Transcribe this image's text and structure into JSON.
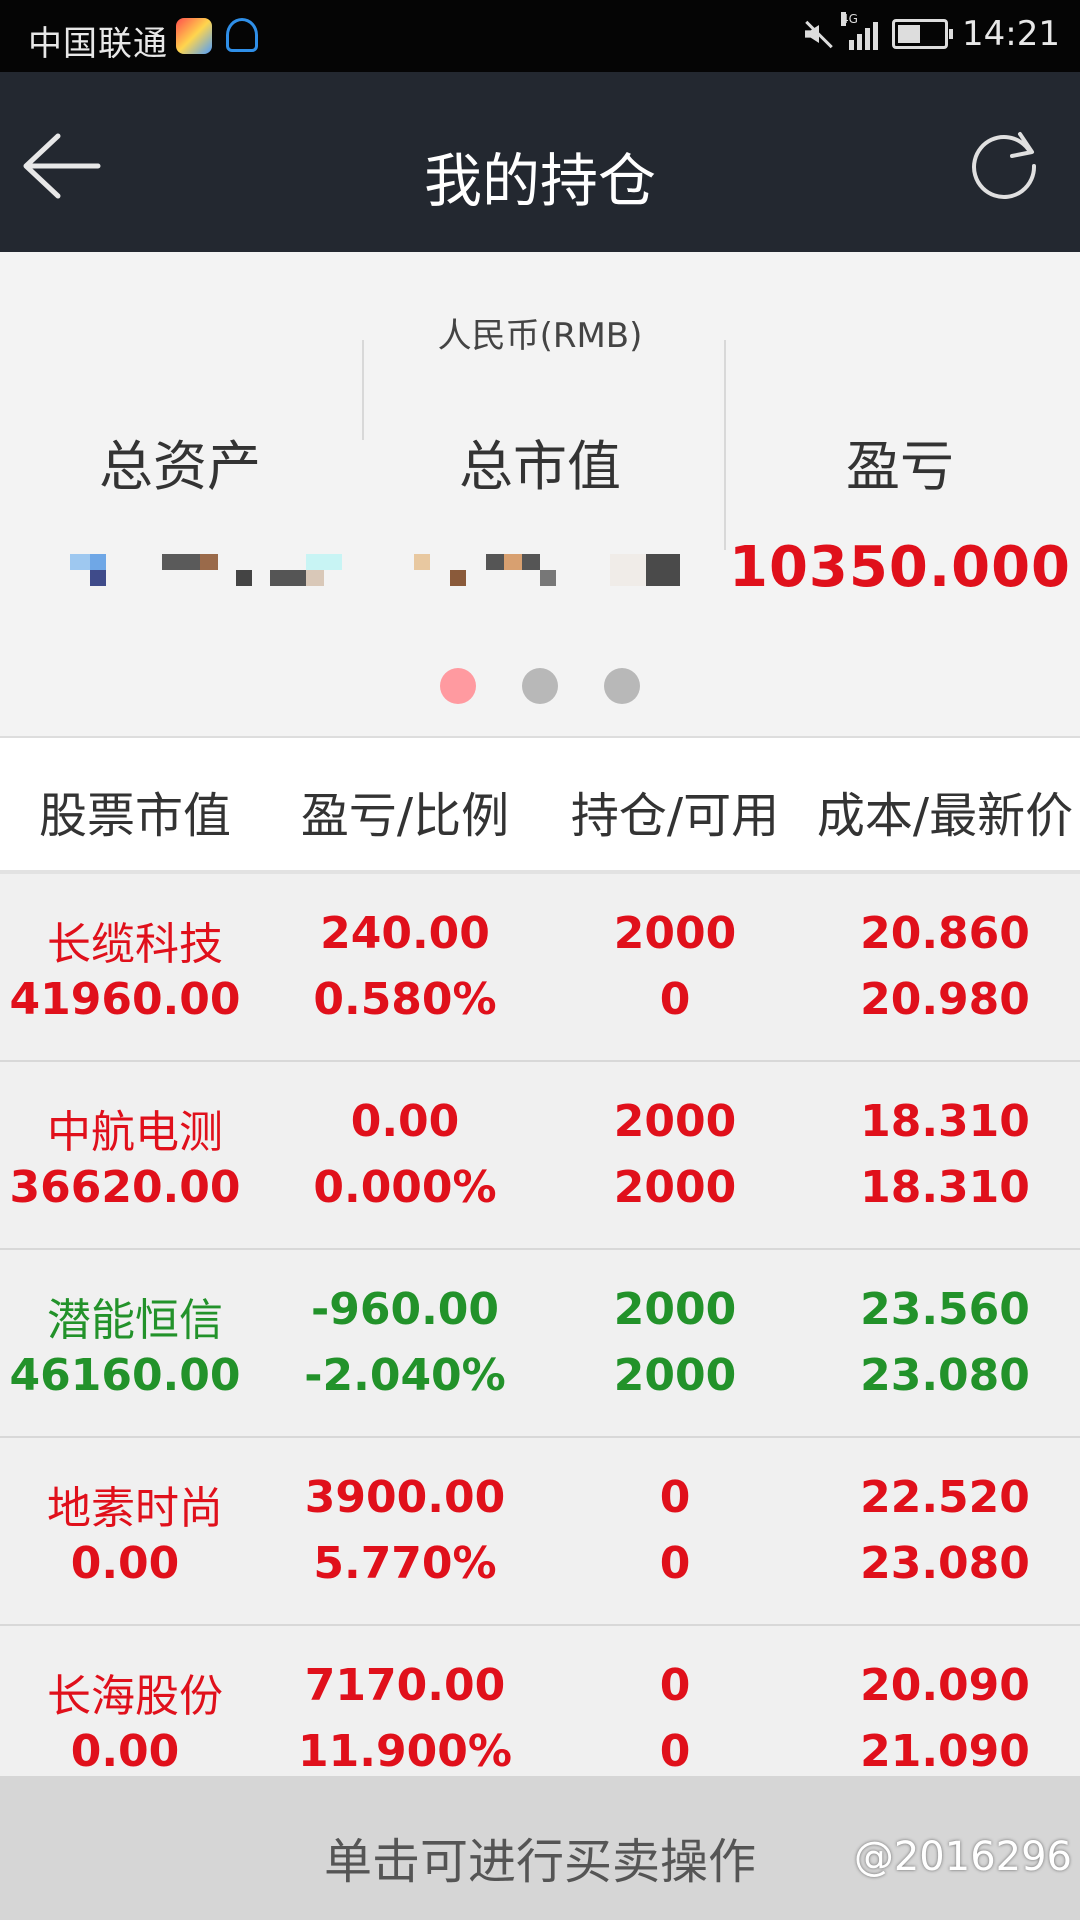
{
  "statusbar": {
    "carrier": "中国联通",
    "net": "4G",
    "time": "14:21"
  },
  "header": {
    "title": "我的持仓"
  },
  "summary": {
    "currency": "人民币(RMB)",
    "labels": [
      "总资产",
      "总市值",
      "盈亏"
    ],
    "profit_value": "10350.000",
    "page_count": 3,
    "active_page": 1
  },
  "table": {
    "headers": [
      "股票市值",
      "盈亏/比例",
      "持仓/可用",
      "成本/最新价"
    ],
    "rows": [
      {
        "color": "#e0101b",
        "name": "长缆科技",
        "market_value": "41960.00",
        "pl": "240.00",
        "pl_pct": "0.580%",
        "position": "2000",
        "available": "0",
        "cost": "20.860",
        "latest": "20.980"
      },
      {
        "color": "#e0101b",
        "name": "中航电测",
        "market_value": "36620.00",
        "pl": "0.00",
        "pl_pct": "0.000%",
        "position": "2000",
        "available": "2000",
        "cost": "18.310",
        "latest": "18.310"
      },
      {
        "color": "#22922a",
        "name": "潜能恒信",
        "market_value": "46160.00",
        "pl": "-960.00",
        "pl_pct": "-2.040%",
        "position": "2000",
        "available": "2000",
        "cost": "23.560",
        "latest": "23.080"
      },
      {
        "color": "#e0101b",
        "name": "地素时尚",
        "market_value": "0.00",
        "pl": "3900.00",
        "pl_pct": "5.770%",
        "position": "0",
        "available": "0",
        "cost": "22.520",
        "latest": "23.080"
      },
      {
        "color": "#e0101b",
        "name": "长海股份",
        "market_value": "0.00",
        "pl": "7170.00",
        "pl_pct": "11.900%",
        "position": "0",
        "available": "0",
        "cost": "20.090",
        "latest": "21.090"
      }
    ]
  },
  "footer": {
    "hint": "单击可进行买卖操作",
    "watermark": "@2016296"
  }
}
